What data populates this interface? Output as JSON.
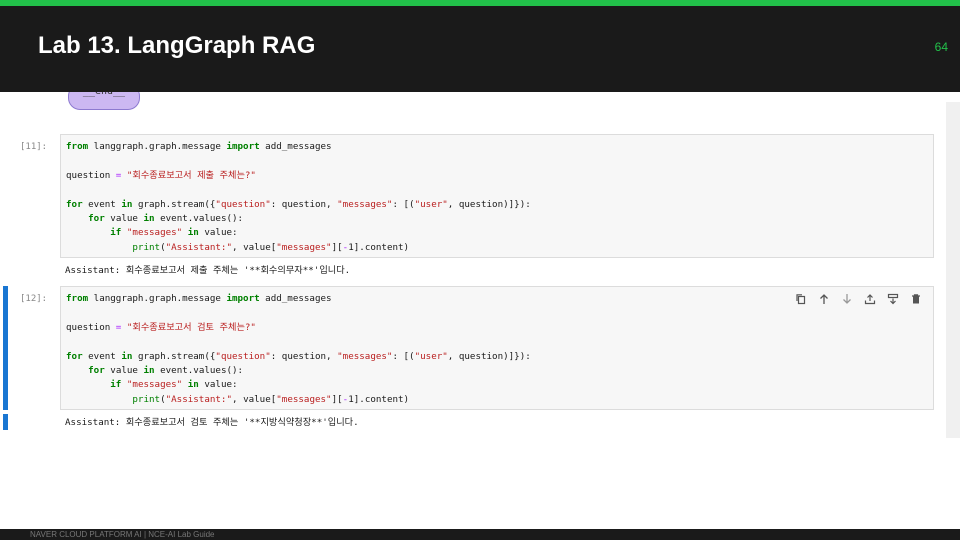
{
  "slide": {
    "title": "Lab 13. LangGraph RAG",
    "page_number": "64",
    "footer": "NAVER CLOUD PLATFORM AI  |  NCE-AI Lab Guide"
  },
  "notebook": {
    "end_node_label": "__end__",
    "cells": [
      {
        "prompt": "[11]:",
        "code": {
          "l1": {
            "kw1": "from",
            "mod": " langgraph.graph.message ",
            "kw2": "import",
            "name": " add_messages"
          },
          "l3": {
            "var": "question ",
            "op": "=",
            "str": " \"회수종료보고서 제출 주체는?\""
          },
          "l5": {
            "kw1": "for",
            "a": " event ",
            "kw2": "in",
            "b": " graph.stream({",
            "s1": "\"question\"",
            "c": ": question, ",
            "s2": "\"messages\"",
            "d": ": [(",
            "s3": "\"user\"",
            "e": ", question)]}):"
          },
          "l6": {
            "kw1": "for",
            "a": " value ",
            "kw2": "in",
            "b": " event.values():"
          },
          "l7": {
            "kw1": "if",
            "s1": " \"messages\"",
            "kw2": " in",
            "b": " value:"
          },
          "l8": {
            "fn": "print",
            "a": "(",
            "s1": "\"Assistant:\"",
            "b": ", value[",
            "s2": "\"messages\"",
            "c": "][",
            "op": "-",
            "d": "1].content)"
          }
        },
        "output": "Assistant: 회수종료보고서 제출 주체는 '**회수의무자**'입니다."
      },
      {
        "prompt": "[12]:",
        "code": {
          "l1": {
            "kw1": "from",
            "mod": " langgraph.graph.message ",
            "kw2": "import",
            "name": " add_messages"
          },
          "l3": {
            "var": "question ",
            "op": "=",
            "str": " \"회수종료보고서 검토 주체는?\""
          },
          "l5": {
            "kw1": "for",
            "a": " event ",
            "kw2": "in",
            "b": " graph.stream({",
            "s1": "\"question\"",
            "c": ": question, ",
            "s2": "\"messages\"",
            "d": ": [(",
            "s3": "\"user\"",
            "e": ", question)]}):"
          },
          "l6": {
            "kw1": "for",
            "a": " value ",
            "kw2": "in",
            "b": " event.values():"
          },
          "l7": {
            "kw1": "if",
            "s1": " \"messages\"",
            "kw2": " in",
            "b": " value:"
          },
          "l8": {
            "fn": "print",
            "a": "(",
            "s1": "\"Assistant:\"",
            "b": ", value[",
            "s2": "\"messages\"",
            "c": "][",
            "op": "-",
            "d": "1].content)"
          }
        },
        "output": "Assistant: 회수종료보고서 검토 주체는 '**지방식약청장**'입니다."
      }
    ],
    "toolbar_icons": [
      "copy-icon",
      "move-up-icon",
      "move-down-icon",
      "insert-above-icon",
      "insert-below-icon",
      "delete-icon"
    ]
  },
  "colors": {
    "accent_green": "#22c14a",
    "header_bg": "#1a1a1a",
    "active_cell_bar": "#1976d2",
    "keyword": "#008000",
    "string": "#ba2121"
  }
}
